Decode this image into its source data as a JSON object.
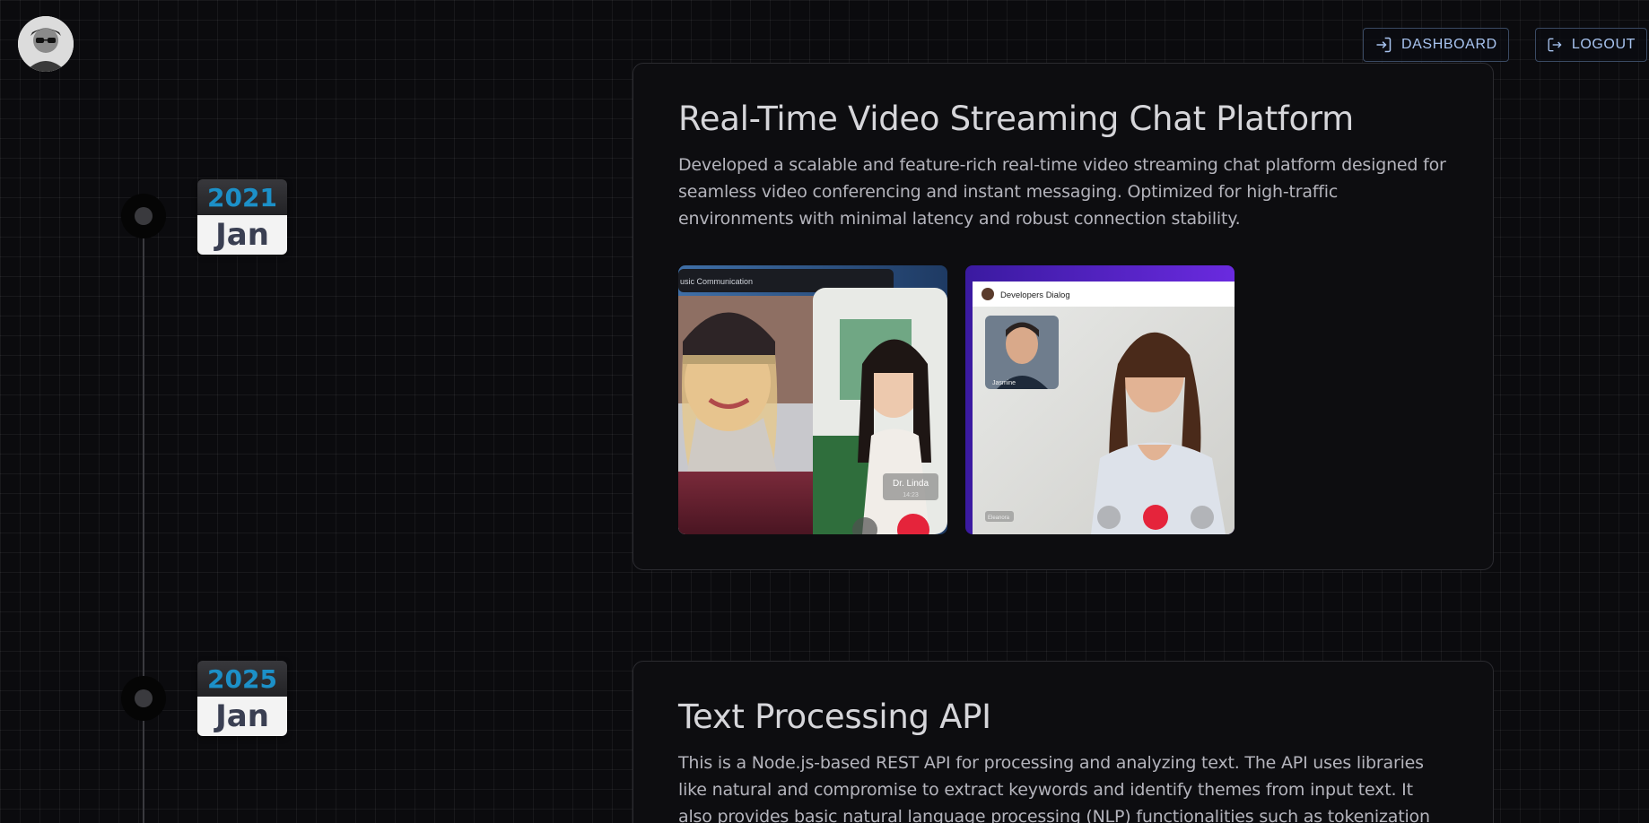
{
  "header": {
    "avatar_alt": "profile avatar",
    "dashboard_label": "DASHBOARD",
    "logout_label": "LOGOUT"
  },
  "timeline": [
    {
      "year": "2021",
      "month": "Jan",
      "title": "Real-Time Video Streaming Chat Platform",
      "description": "Developed a scalable and feature-rich real-time video streaming chat platform designed for seamless video conferencing and instant messaging. Optimized for high-traffic environments with minimal latency and robust connection stability.",
      "screenshots": [
        {
          "header_text": "usic Communication",
          "caller_name": "Dr. Linda",
          "caller_time": "14:23"
        },
        {
          "header_text": "Developers Dialog",
          "thumb_name": "Jasmine",
          "self_label": "Eleanora"
        }
      ]
    },
    {
      "year": "2025",
      "month": "Jan",
      "title": "Text Processing API",
      "description": "This is a Node.js-based REST API for processing and analyzing text. The API uses libraries like natural and compromise to extract keywords and identify themes from input text. It also provides basic natural language processing (NLP) functionalities such as tokenization and part-of-speech"
    }
  ],
  "colors": {
    "background": "#0b0b0e",
    "year_accent": "#1c90c8",
    "nav_text": "#a8c4f0",
    "end_call": "#e5243b"
  },
  "icons": {
    "dashboard": "login-icon",
    "logout": "logout-icon"
  }
}
